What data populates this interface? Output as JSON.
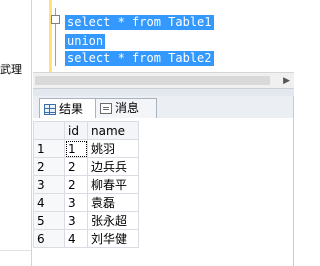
{
  "left_panel": {
    "text": "武理"
  },
  "editor": {
    "lines": [
      "select * from Table1",
      "union",
      "select * from Table2"
    ]
  },
  "tabs": [
    {
      "label": "结果",
      "icon": "grid-icon",
      "active": true
    },
    {
      "label": "消息",
      "icon": "message-icon",
      "active": false
    }
  ],
  "results": {
    "columns": [
      "id",
      "name"
    ],
    "rows": [
      {
        "rownum": "1",
        "id": "1",
        "name": "姚羽"
      },
      {
        "rownum": "2",
        "id": "2",
        "name": "边兵兵"
      },
      {
        "rownum": "3",
        "id": "2",
        "name": "柳春平"
      },
      {
        "rownum": "4",
        "id": "3",
        "name": "袁磊"
      },
      {
        "rownum": "5",
        "id": "3",
        "name": "张永超"
      },
      {
        "rownum": "6",
        "id": "4",
        "name": "刘华健"
      }
    ]
  },
  "colors": {
    "selection": "#3399ff",
    "gutter": "#ffe27a"
  }
}
